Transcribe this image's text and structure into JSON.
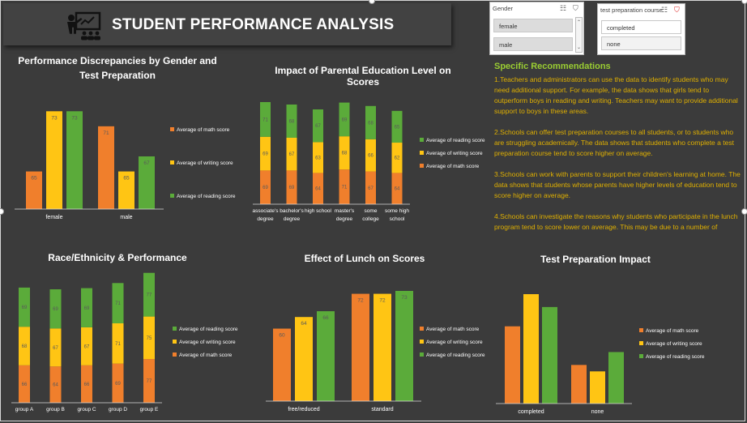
{
  "header": {
    "title": "STUDENT PERFORMANCE ANALYSIS",
    "icon": "teacher-presentation-icon"
  },
  "slicers": {
    "gender": {
      "label": "Gender",
      "items": [
        "female",
        "male"
      ]
    },
    "prep": {
      "label": "test preparation course",
      "items": [
        "completed",
        "none"
      ]
    }
  },
  "recommendations": {
    "title": "Specific Recommendations",
    "paragraphs": [
      "1.Teachers and administrators can use the data to identify students who may need additional support.  For example, the data shows that girls tend to outperform boys in reading and writing. Teachers may want to provide additional support to boys in these areas.",
      "2.Schools can offer test preparation courses to all students, or to students who are struggling academically. The data shows that students who complete a test preparation course tend to score higher on average.",
      "3.Schools can work with parents to support their children's learning at home.  The data shows that students whose parents have higher levels of education tend to score higher on average.",
      "4.Schools can investigate the reasons why students who participate in the lunch program tend to score lower on average.  This may be due to a number of"
    ]
  },
  "colors": {
    "math": "#f07f2c",
    "writing": "#ffc514",
    "reading": "#5bab3a",
    "label": "#5a5a5a",
    "axis": "#ffffff"
  },
  "chart_data": [
    {
      "id": "gender",
      "type": "bar",
      "title": "Performance Discrepancies by Gender and Test Preparation",
      "title_lines": [
        "Performance Discrepancies by Gender and",
        "Test Preparation"
      ],
      "categories": [
        "female",
        "male"
      ],
      "series": [
        {
          "name": "Average of math score",
          "values": [
            65,
            71
          ]
        },
        {
          "name": "Average of writing score",
          "values": [
            73,
            65
          ]
        },
        {
          "name": "Average of reading score",
          "values": [
            73,
            67
          ]
        }
      ],
      "ylim": [
        60,
        74
      ],
      "legend": "right"
    },
    {
      "id": "parental",
      "type": "bar",
      "stacked": true,
      "title": "Impact of Parental Education Level on Scores",
      "categories": [
        "associate's degree",
        "bachelor's degree",
        "high school",
        "master's degree",
        "some college",
        "some high school"
      ],
      "category_lines": [
        [
          "associate's",
          "degree"
        ],
        [
          "bachelor's",
          "degree"
        ],
        [
          "high school"
        ],
        [
          "master's",
          "degree"
        ],
        [
          "some",
          "college"
        ],
        [
          "some high",
          "school"
        ]
      ],
      "series": [
        {
          "name": "Average of math score",
          "values": [
            69,
            69,
            64,
            71,
            67,
            64
          ]
        },
        {
          "name": "Average of writing score",
          "values": [
            69,
            67,
            63,
            68,
            66,
            62
          ]
        },
        {
          "name": "Average of reading score",
          "values": [
            71,
            68,
            67,
            69,
            68,
            65
          ]
        }
      ],
      "legend_order": [
        "Average of reading score",
        "Average of writing score",
        "Average of math score"
      ],
      "legend": "right"
    },
    {
      "id": "race",
      "type": "bar",
      "stacked": true,
      "title": "Race/Ethnicity & Performance",
      "categories": [
        "group A",
        "group B",
        "group C",
        "group D",
        "group E"
      ],
      "series": [
        {
          "name": "Average of math score",
          "values": [
            66,
            64,
            66,
            69,
            77
          ]
        },
        {
          "name": "Average of writing score",
          "values": [
            68,
            67,
            67,
            71,
            75
          ]
        },
        {
          "name": "Average of reading score",
          "values": [
            69,
            69,
            69,
            71,
            77
          ]
        }
      ],
      "legend_order": [
        "Average of reading score",
        "Average of writing score",
        "Average of math score"
      ],
      "legend": "right"
    },
    {
      "id": "lunch",
      "type": "bar",
      "title": "Effect of Lunch on Scores",
      "categories": [
        "free/reduced",
        "standard"
      ],
      "series": [
        {
          "name": "Average of math score",
          "values": [
            60,
            72
          ]
        },
        {
          "name": "Average of writing score",
          "values": [
            64,
            72
          ]
        },
        {
          "name": "Average of reading score",
          "values": [
            66,
            73
          ]
        }
      ],
      "ylim": [
        35,
        73
      ],
      "legend": "right"
    },
    {
      "id": "prep",
      "type": "bar",
      "title": "Test Preparation Impact",
      "categories": [
        "completed",
        "none"
      ],
      "series": [
        {
          "name": "Average of math score",
          "values": [
            70,
            64
          ]
        },
        {
          "name": "Average of writing score",
          "values": [
            75,
            63
          ]
        },
        {
          "name": "Average of reading score",
          "values": [
            73,
            66
          ]
        }
      ],
      "ylim": [
        58,
        75
      ],
      "legend": "right"
    }
  ]
}
